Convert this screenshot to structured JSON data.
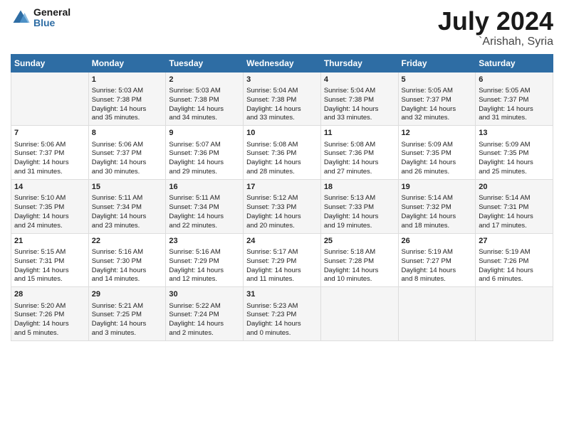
{
  "logo": {
    "text_general": "General",
    "text_blue": "Blue"
  },
  "title": "July 2024",
  "subtitle": "`Arishah, Syria",
  "days_header": [
    "Sunday",
    "Monday",
    "Tuesday",
    "Wednesday",
    "Thursday",
    "Friday",
    "Saturday"
  ],
  "weeks": [
    [
      {
        "day": "",
        "content": ""
      },
      {
        "day": "1",
        "content": "Sunrise: 5:03 AM\nSunset: 7:38 PM\nDaylight: 14 hours\nand 35 minutes."
      },
      {
        "day": "2",
        "content": "Sunrise: 5:03 AM\nSunset: 7:38 PM\nDaylight: 14 hours\nand 34 minutes."
      },
      {
        "day": "3",
        "content": "Sunrise: 5:04 AM\nSunset: 7:38 PM\nDaylight: 14 hours\nand 33 minutes."
      },
      {
        "day": "4",
        "content": "Sunrise: 5:04 AM\nSunset: 7:38 PM\nDaylight: 14 hours\nand 33 minutes."
      },
      {
        "day": "5",
        "content": "Sunrise: 5:05 AM\nSunset: 7:37 PM\nDaylight: 14 hours\nand 32 minutes."
      },
      {
        "day": "6",
        "content": "Sunrise: 5:05 AM\nSunset: 7:37 PM\nDaylight: 14 hours\nand 31 minutes."
      }
    ],
    [
      {
        "day": "7",
        "content": "Sunrise: 5:06 AM\nSunset: 7:37 PM\nDaylight: 14 hours\nand 31 minutes."
      },
      {
        "day": "8",
        "content": "Sunrise: 5:06 AM\nSunset: 7:37 PM\nDaylight: 14 hours\nand 30 minutes."
      },
      {
        "day": "9",
        "content": "Sunrise: 5:07 AM\nSunset: 7:36 PM\nDaylight: 14 hours\nand 29 minutes."
      },
      {
        "day": "10",
        "content": "Sunrise: 5:08 AM\nSunset: 7:36 PM\nDaylight: 14 hours\nand 28 minutes."
      },
      {
        "day": "11",
        "content": "Sunrise: 5:08 AM\nSunset: 7:36 PM\nDaylight: 14 hours\nand 27 minutes."
      },
      {
        "day": "12",
        "content": "Sunrise: 5:09 AM\nSunset: 7:35 PM\nDaylight: 14 hours\nand 26 minutes."
      },
      {
        "day": "13",
        "content": "Sunrise: 5:09 AM\nSunset: 7:35 PM\nDaylight: 14 hours\nand 25 minutes."
      }
    ],
    [
      {
        "day": "14",
        "content": "Sunrise: 5:10 AM\nSunset: 7:35 PM\nDaylight: 14 hours\nand 24 minutes."
      },
      {
        "day": "15",
        "content": "Sunrise: 5:11 AM\nSunset: 7:34 PM\nDaylight: 14 hours\nand 23 minutes."
      },
      {
        "day": "16",
        "content": "Sunrise: 5:11 AM\nSunset: 7:34 PM\nDaylight: 14 hours\nand 22 minutes."
      },
      {
        "day": "17",
        "content": "Sunrise: 5:12 AM\nSunset: 7:33 PM\nDaylight: 14 hours\nand 20 minutes."
      },
      {
        "day": "18",
        "content": "Sunrise: 5:13 AM\nSunset: 7:33 PM\nDaylight: 14 hours\nand 19 minutes."
      },
      {
        "day": "19",
        "content": "Sunrise: 5:14 AM\nSunset: 7:32 PM\nDaylight: 14 hours\nand 18 minutes."
      },
      {
        "day": "20",
        "content": "Sunrise: 5:14 AM\nSunset: 7:31 PM\nDaylight: 14 hours\nand 17 minutes."
      }
    ],
    [
      {
        "day": "21",
        "content": "Sunrise: 5:15 AM\nSunset: 7:31 PM\nDaylight: 14 hours\nand 15 minutes."
      },
      {
        "day": "22",
        "content": "Sunrise: 5:16 AM\nSunset: 7:30 PM\nDaylight: 14 hours\nand 14 minutes."
      },
      {
        "day": "23",
        "content": "Sunrise: 5:16 AM\nSunset: 7:29 PM\nDaylight: 14 hours\nand 12 minutes."
      },
      {
        "day": "24",
        "content": "Sunrise: 5:17 AM\nSunset: 7:29 PM\nDaylight: 14 hours\nand 11 minutes."
      },
      {
        "day": "25",
        "content": "Sunrise: 5:18 AM\nSunset: 7:28 PM\nDaylight: 14 hours\nand 10 minutes."
      },
      {
        "day": "26",
        "content": "Sunrise: 5:19 AM\nSunset: 7:27 PM\nDaylight: 14 hours\nand 8 minutes."
      },
      {
        "day": "27",
        "content": "Sunrise: 5:19 AM\nSunset: 7:26 PM\nDaylight: 14 hours\nand 6 minutes."
      }
    ],
    [
      {
        "day": "28",
        "content": "Sunrise: 5:20 AM\nSunset: 7:26 PM\nDaylight: 14 hours\nand 5 minutes."
      },
      {
        "day": "29",
        "content": "Sunrise: 5:21 AM\nSunset: 7:25 PM\nDaylight: 14 hours\nand 3 minutes."
      },
      {
        "day": "30",
        "content": "Sunrise: 5:22 AM\nSunset: 7:24 PM\nDaylight: 14 hours\nand 2 minutes."
      },
      {
        "day": "31",
        "content": "Sunrise: 5:23 AM\nSunset: 7:23 PM\nDaylight: 14 hours\nand 0 minutes."
      },
      {
        "day": "",
        "content": ""
      },
      {
        "day": "",
        "content": ""
      },
      {
        "day": "",
        "content": ""
      }
    ]
  ]
}
